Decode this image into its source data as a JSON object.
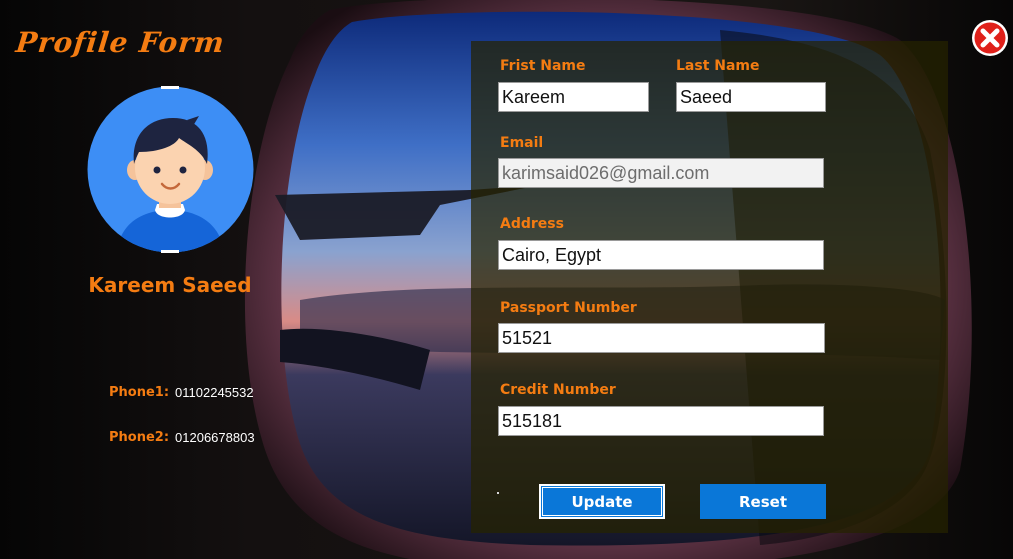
{
  "window": {
    "title": "Profile Form",
    "close_icon": "close-icon"
  },
  "profile": {
    "avatar_icon": "user-avatar-icon",
    "display_name": "Kareem Saeed",
    "phone1_label": "Phone1:",
    "phone1_value": "01102245532",
    "phone2_label": "Phone2:",
    "phone2_value": "01206678803"
  },
  "form": {
    "first_name": {
      "label": "Frist Name",
      "value": "Kareem"
    },
    "last_name": {
      "label": "Last Name",
      "value": "Saeed"
    },
    "email": {
      "label": "Email",
      "value": "karimsaid026@gmail.com"
    },
    "address": {
      "label": "Address",
      "value": "Cairo, Egypt"
    },
    "passport": {
      "label": "Passport Number",
      "value": "51521"
    },
    "credit": {
      "label": "Credit Number",
      "value": "515181"
    }
  },
  "buttons": {
    "update_label": "Update",
    "reset_label": "Reset"
  },
  "colors": {
    "accent": "#f47c12",
    "button": "#0a77d8",
    "close_red": "#e0201a"
  }
}
